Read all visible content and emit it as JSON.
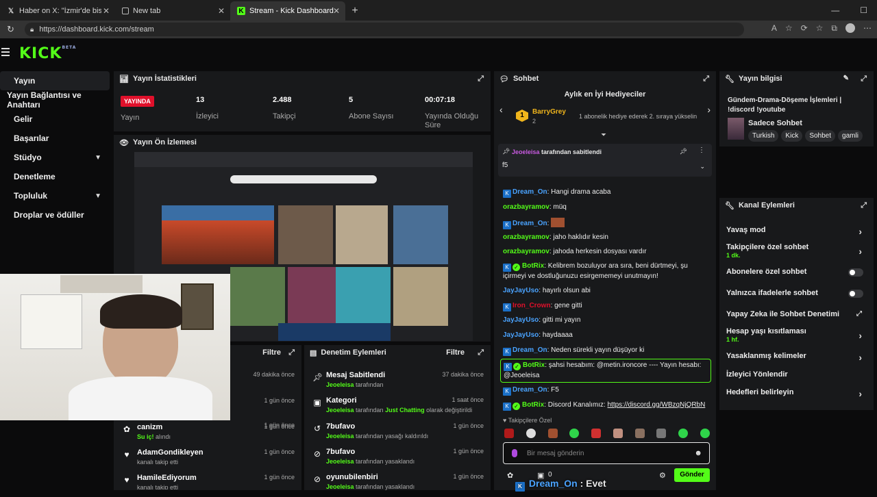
{
  "browser": {
    "tabs": [
      {
        "title": "Haber on X: \"İzmir'de bisikletliyi s...",
        "icon": "x-logo-icon"
      },
      {
        "title": "New tab",
        "icon": "newtab-icon"
      },
      {
        "title": "Stream - Kick Dashboard",
        "icon": "kick-icon"
      }
    ],
    "url": "https://dashboard.kick.com/stream"
  },
  "header": {
    "logo": "KICK",
    "logo_sup": "BETA"
  },
  "nav": {
    "items": [
      {
        "label": "Yayın",
        "active": true
      },
      {
        "label": "Yayın Bağlantısı ve Anahtarı"
      },
      {
        "label": "Gelir"
      },
      {
        "label": "Başarılar"
      },
      {
        "label": "Stüdyo"
      },
      {
        "label": "Denetleme"
      },
      {
        "label": "Topluluk"
      },
      {
        "label": "Droplar ve ödüller"
      }
    ]
  },
  "stats": {
    "title": "Yayın İstatistikleri",
    "live_badge": "YAYINDA",
    "live_label": "Yayın",
    "viewers": "13",
    "viewers_label": "İzleyici",
    "followers": "2.488",
    "followers_label": "Takipçi",
    "subs": "5",
    "subs_label": "Abone Sayısı",
    "uptime": "00:07:18",
    "uptime_label": "Yayında Olduğu Süre"
  },
  "preview": {
    "title": "Yayın Ön İzlemesi"
  },
  "activity": {
    "filter": "Filtre",
    "rows": [
      {
        "ago": "49 dakika önce"
      },
      {
        "ago": "1 gün önce"
      },
      {
        "ago": "1 gün önce"
      },
      {
        "title": "canizm",
        "sub_green": "Su iç!",
        "sub": " alındı",
        "ago": "1 gün önce"
      },
      {
        "title": "AdamGondikleyen",
        "sub": "kanalı takip etti",
        "ago": "1 gün önce"
      },
      {
        "title": "HamileEdiyorum",
        "sub": "kanalı takip etti",
        "ago": "1 gün önce"
      }
    ]
  },
  "modlog": {
    "title": "Denetim Eylemleri",
    "filter": "Filtre",
    "rows": [
      {
        "title": "Mesaj Sabitlendi",
        "user": "Jeoeleisa",
        "sub": " tarafından",
        "ago": "37 dakika önce"
      },
      {
        "title": "Kategori",
        "user": "Jeoeleisa",
        "sub": " tarafından ",
        "extra": "Just Chatting",
        "sub2": " olarak değiştirildi",
        "ago": "1 saat önce"
      },
      {
        "title": "7bufavo",
        "user": "Jeoeleisa",
        "sub": " tarafından yasağı kaldırıldı",
        "ago": "1 gün önce"
      },
      {
        "title": "7bufavo",
        "user": "Jeoeleisa",
        "sub": " tarafından yasaklandı",
        "ago": "1 gün önce"
      },
      {
        "title": "oyunubilenbiri",
        "user": "Jeoeleisa",
        "sub": " tarafından yasaklandı",
        "ago": "1 gün önce"
      }
    ]
  },
  "chat": {
    "title": "Sohbet",
    "gifters_title": "Aylık en İyi Hediyeciler",
    "top_gifter": "BarryGrey",
    "top_gifter_count": "2",
    "gifter_rank": "1",
    "gifter_hint": "1 abonelik hediye ederek 2. sıraya yükselin",
    "pinned_by": "Jeoeleisa",
    "pinned_suffix": " tarafından sabitlendi",
    "pinned_msg": "f5",
    "messages": [
      {
        "user": "Dream_On",
        "color": "#4aa3ff",
        "text": ": Hangi drama acaba",
        "badges": [
          "k"
        ]
      },
      {
        "user": "orazbayramov",
        "color": "#53fc18",
        "text": ": müq",
        "badges": []
      },
      {
        "user": "Dream_On",
        "color": "#4aa3ff",
        "text": ": ",
        "badges": [
          "k"
        ]
      },
      {
        "user": "orazbayramov",
        "color": "#53fc18",
        "text": ": jaho haklıdır kesin",
        "badges": []
      },
      {
        "user": "orazbayramov",
        "color": "#53fc18",
        "text": ": jahoda herkesin dosyası vardır",
        "badges": []
      },
      {
        "user": "BotRix",
        "color": "#53fc18",
        "text": ": Kelibrem bozuluyor ara sıra, beni dürtmeyi, şu içirmeyi ve dostluğunuzu esirgememeyi unutmayın!",
        "badges": [
          "k",
          "v"
        ]
      },
      {
        "user": "JayJayUso",
        "color": "#4aa3ff",
        "text": ": hayırlı olsun abi",
        "badges": []
      },
      {
        "user": "Iron_Crown",
        "color": "#e0102b",
        "text": ": gene gitti",
        "badges": [
          "k"
        ]
      },
      {
        "user": "JayJayUso",
        "color": "#4aa3ff",
        "text": ": gitti mi yayın",
        "badges": []
      },
      {
        "user": "JayJayUso",
        "color": "#4aa3ff",
        "text": ": haydaaaa",
        "badges": []
      },
      {
        "user": "Dream_On",
        "color": "#4aa3ff",
        "text": ": Neden sürekli yayın düşüyor ki",
        "badges": [
          "k"
        ]
      },
      {
        "user": "BotRix",
        "color": "#53fc18",
        "text": ": şahsi hesabım: @metin.ironcore ---- Yayın hesabı: @Jeoeleisa",
        "badges": [
          "k",
          "v"
        ]
      },
      {
        "user": "Dream_On",
        "color": "#4aa3ff",
        "text": ": F5",
        "badges": [
          "k"
        ]
      },
      {
        "user": "BotRix",
        "color": "#53fc18",
        "text": ": Discord Kanalımız: ",
        "link": "https://discord.gg/WBzqNjQRbN",
        "badges": [
          "k",
          "v"
        ]
      }
    ],
    "followers_only": "Takipçilere Özel",
    "input_placeholder": "Bir mesaj gönderin",
    "send": "Gönder",
    "coin_count": "0",
    "overlay_user": "Dream_On",
    "overlay_text": " : Evet"
  },
  "stream_info": {
    "title": "Yayın bilgisi",
    "stream_title": "Gündem-Drama-Döşeme İşlemleri | !discord !youtube",
    "category": "Sadece Sohbet",
    "tags": [
      "Turkish",
      "Kick",
      "Sohbet",
      "gamli"
    ]
  },
  "channel_actions": {
    "title": "Kanal Eylemleri",
    "rows": [
      {
        "label": "Yavaş mod",
        "control": "chevron"
      },
      {
        "label": "Takipçilere özel sohbet",
        "sub": "1 dk.",
        "control": "chevron"
      },
      {
        "label": "Abonelere özel sohbet",
        "control": "toggle"
      },
      {
        "label": "Yalnızca ifadelerle sohbet",
        "control": "toggle"
      },
      {
        "label": "Yapay Zeka ile Sohbet Denetimi",
        "control": "external"
      },
      {
        "label": "Hesap yaşı kısıtlaması",
        "sub": "1 hf.",
        "control": "chevron"
      },
      {
        "label": "Yasaklanmış kelimeler",
        "control": "chevron"
      },
      {
        "label": "İzleyici Yönlendir",
        "control": "none"
      },
      {
        "label": "Hedefleri belirleyin",
        "control": "chevron"
      }
    ]
  }
}
